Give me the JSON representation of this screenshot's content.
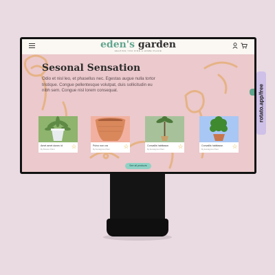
{
  "header": {
    "logo_part1": "eden's",
    "logo_part2": "garden",
    "tagline": "HELPING YOU FIND A HOME PLACE"
  },
  "hero": {
    "title": "Sesonal Sensation",
    "description": "Odio et nisl leo, et phasellus nec. Egestas augue nulla tortor tristique. Congue pellentesque volutpat, duis sollicitudin eu nibh sem. Congue nisl lorem consequat."
  },
  "products": [
    {
      "name": "Amet amet donec id",
      "sub": "By Botanic Plant",
      "bg": "#8eb46e"
    },
    {
      "name": "Pulvo non cra",
      "sub": "By Eucalyptus Plant",
      "bg": "#f2b1a0"
    },
    {
      "name": "Convallis habitasse.",
      "sub": "By Eucalyptus Plant",
      "bg": "#a7c29b"
    },
    {
      "name": "Convallis habitasse.",
      "sub": "By Eucalyptus Plant",
      "bg": "#a9c7f4"
    }
  ],
  "see_all_label": "See all products",
  "watermark": "rotato.app/free",
  "colors": {
    "page_bg": "#eadbe2",
    "screen_bg": "#ebc9cc",
    "logo_green": "#5fa58e",
    "button_teal": "#8fd2c5",
    "star": "#e0b441",
    "side_tab": "#cfc0e8"
  }
}
